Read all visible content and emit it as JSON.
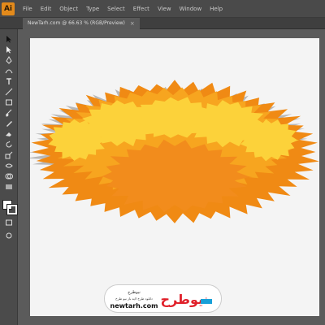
{
  "app": {
    "logo_text": "Ai",
    "accent": "#e38a1b"
  },
  "menu": [
    "File",
    "Edit",
    "Object",
    "Type",
    "Select",
    "Effect",
    "View",
    "Window",
    "Help"
  ],
  "document_tab": {
    "title": "NewTarh.com @ 66.63 % (RGB/Preview)",
    "close_glyph": "×"
  },
  "tools": [
    "selection-tool",
    "direct-selection-tool",
    "pen-tool",
    "curvature-tool",
    "type-tool",
    "line-tool",
    "rectangle-tool",
    "paintbrush-tool",
    "pencil-tool",
    "eraser-tool",
    "rotate-tool",
    "scale-tool",
    "width-tool",
    "free-transform-tool",
    "shape-builder-tool",
    "perspective-tool",
    "mesh-tool",
    "gradient-tool",
    "eyedropper-tool",
    "blend-tool",
    "symbol-sprayer-tool",
    "graph-tool",
    "artboard-tool",
    "slice-tool",
    "hand-tool",
    "zoom-tool"
  ],
  "colors": {
    "artboard": "#f4f4f4",
    "shadow": "#b8b8b8",
    "dark_orange": "#f08a14",
    "mid_orange": "#f7a51f",
    "yellow": "#fcd23a",
    "center": "#f28c1c"
  },
  "watermark": {
    "logo_text": "نیوطرح",
    "title": "نیوطرح",
    "subtitle": "دانلود طرح لایه باز نیو طرح",
    "site": "newtarh.com"
  }
}
